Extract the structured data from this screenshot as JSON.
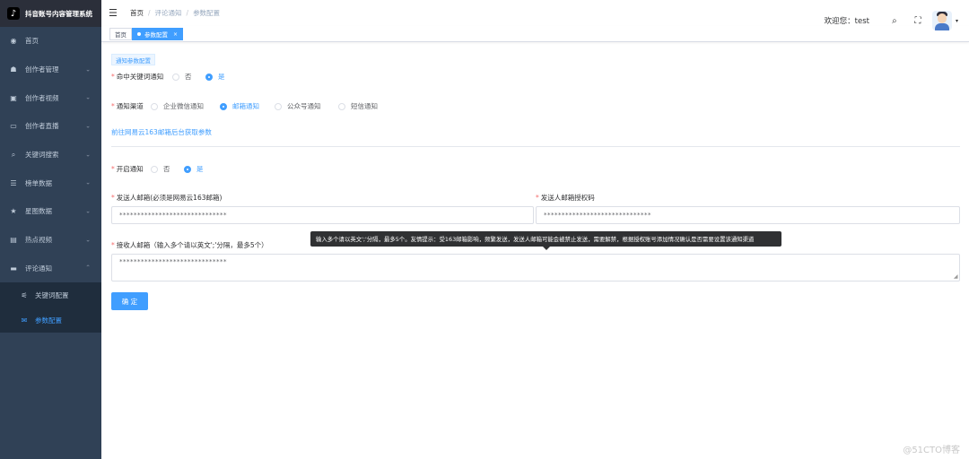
{
  "app": {
    "title": "抖音账号内容管理系统",
    "logo_char": "♪"
  },
  "sidebar": {
    "items": [
      {
        "label": "首页",
        "icon": "dashboard-icon",
        "glyph": "◉",
        "expandable": false
      },
      {
        "label": "创作者管理",
        "icon": "user-manage-icon",
        "glyph": "☗",
        "expandable": true
      },
      {
        "label": "创作者视频",
        "icon": "video-icon",
        "glyph": "▣",
        "expandable": true
      },
      {
        "label": "创作者直播",
        "icon": "live-icon",
        "glyph": "▭",
        "expandable": true
      },
      {
        "label": "关键词搜索",
        "icon": "search-keyword-icon",
        "glyph": "⌕",
        "expandable": true
      },
      {
        "label": "榜单数据",
        "icon": "list-icon",
        "glyph": "☰",
        "expandable": true
      },
      {
        "label": "星图数据",
        "icon": "star-icon",
        "glyph": "★",
        "expandable": true
      },
      {
        "label": "热点视频",
        "icon": "hot-video-icon",
        "glyph": "▤",
        "expandable": true
      },
      {
        "label": "评论通知",
        "icon": "comment-icon",
        "glyph": "▬",
        "expandable": true,
        "expanded": true
      }
    ],
    "sub_items": [
      {
        "label": "关键词配置",
        "icon": "keyword-config-icon",
        "glyph": "⚟",
        "active": false
      },
      {
        "label": "参数配置",
        "icon": "param-config-icon",
        "glyph": "✉",
        "active": true
      }
    ]
  },
  "header": {
    "breadcrumb": [
      "首页",
      "评论通知",
      "参数配置"
    ],
    "welcome": "欢迎您：test",
    "search_glyph": "⌕",
    "fullscreen_glyph": "⛶",
    "caret": "▾"
  },
  "tags": [
    {
      "label": "首页",
      "active": false
    },
    {
      "label": "参数配置",
      "active": true,
      "close": "×"
    }
  ],
  "form": {
    "section_tag": "通知参数配置",
    "keyword_notify": {
      "label": "命中关键词通知",
      "options": [
        "否",
        "是"
      ],
      "selected": "是"
    },
    "channel": {
      "label": "通知渠道",
      "options": [
        "企业微信通知",
        "邮箱通知",
        "公众号通知",
        "短信通知"
      ],
      "selected": "邮箱通知"
    },
    "help_link": "前往网易云163邮箱后台获取参数",
    "enable_notify": {
      "label": "开启通知",
      "options": [
        "否",
        "是"
      ],
      "selected": "是"
    },
    "sender_email": {
      "label": "发送人邮箱(必须是网易云163邮箱)",
      "value": "******************************"
    },
    "sender_auth": {
      "label": "发送人邮箱授权码",
      "value": "******************************"
    },
    "receiver": {
      "label": "接收人邮箱（输入多个请以英文';'分隔，最多5个）",
      "value": "******************************"
    },
    "tooltip": "输入多个请以英文';'分隔，最多5个。友情提示：受163邮箱影响，频繁发送，发送人邮箱可能会被禁止发送，需要解禁，根据授权账号添加情况确认是否需要设置该通知渠道",
    "submit": "确 定"
  },
  "watermark": "@51CTO博客",
  "colors": {
    "sidebar_bg": "#304156",
    "accent": "#409eff",
    "tooltip_bg": "#303133",
    "required": "#f56c6c"
  }
}
